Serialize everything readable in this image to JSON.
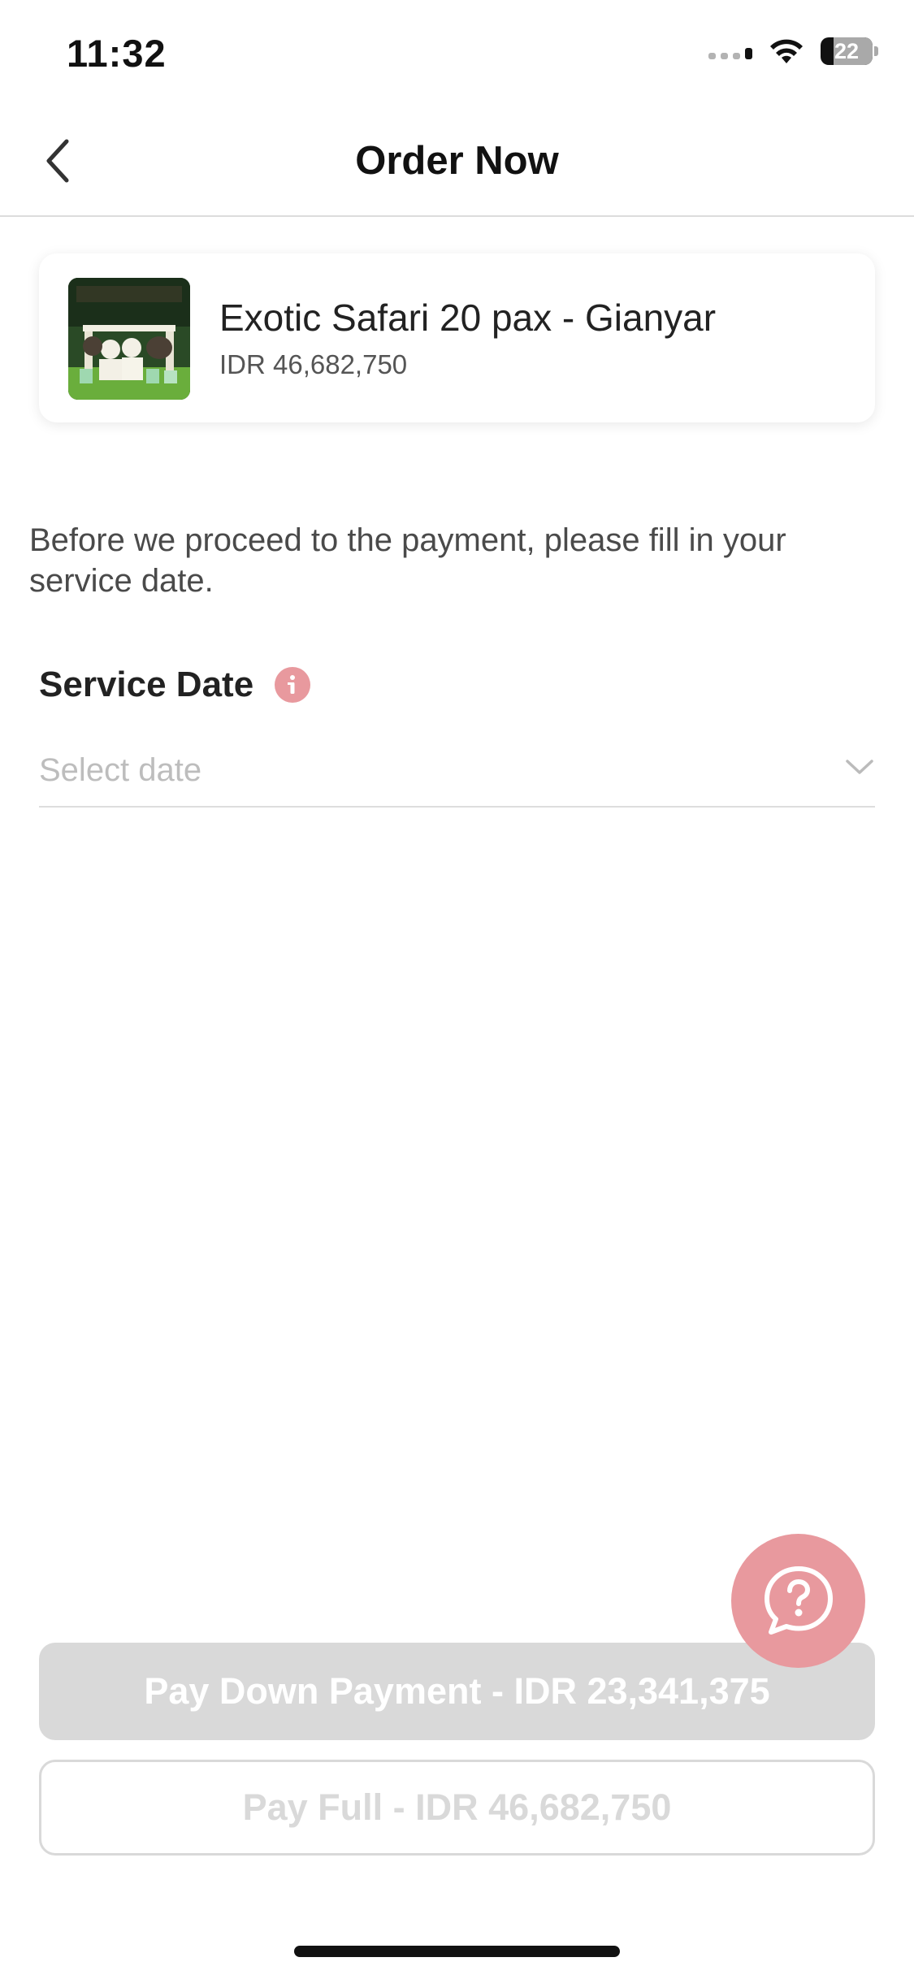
{
  "status_bar": {
    "time": "11:32",
    "battery": "22"
  },
  "nav": {
    "title": "Order Now",
    "back_icon": "chevron-left-icon"
  },
  "product": {
    "name": "Exotic Safari 20 pax - Gianyar",
    "price": "IDR 46,682,750"
  },
  "instruction": "Before we proceed to the payment, please fill in your service date.",
  "service_date": {
    "label": "Service Date",
    "info_icon": "info-icon",
    "placeholder": "Select date",
    "chevron_icon": "chevron-down-icon"
  },
  "help": {
    "icon": "help-chat-icon"
  },
  "actions": {
    "pay_down_label": "Pay Down Payment - IDR 23,341,375",
    "pay_full_label": "Pay Full - IDR 46,682,750"
  },
  "colors": {
    "accent_pink": "#e8999e",
    "disabled_gray": "#d9d9d9"
  }
}
